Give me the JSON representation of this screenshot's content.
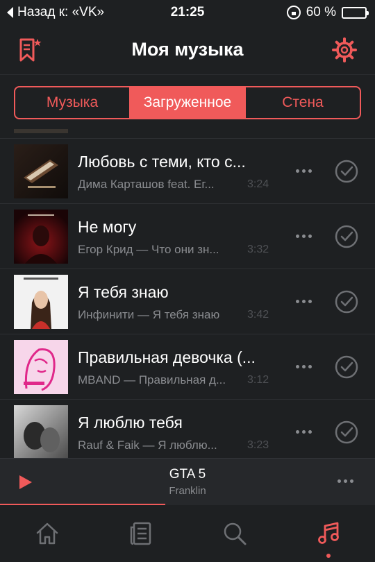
{
  "status_bar": {
    "back_label": "Назад к: «VK»",
    "time": "21:25",
    "battery": "60 %",
    "battery_level": 0.6
  },
  "header": {
    "title": "Моя музыка"
  },
  "segments": [
    {
      "label": "Музыка",
      "active": false
    },
    {
      "label": "Загруженное",
      "active": true
    },
    {
      "label": "Стена",
      "active": false
    }
  ],
  "tracks": [
    {
      "title": "Любовь с теми, кто с...",
      "subtitle": "Дима Карташов feat. Ег...",
      "duration": "3:24",
      "cover_icon": "album-cover-dark-piano"
    },
    {
      "title": "Не могу",
      "subtitle": "Егор Крид — Что они зн...",
      "duration": "3:32",
      "cover_icon": "album-cover-red"
    },
    {
      "title": "Я тебя знаю",
      "subtitle": "Инфинити — Я тебя знаю",
      "duration": "3:42",
      "cover_icon": "album-cover-girl"
    },
    {
      "title": "Правильная девочка (...",
      "subtitle": "MBAND — Правильная д...",
      "duration": "3:12",
      "cover_icon": "album-cover-pink"
    },
    {
      "title": "Я люблю тебя",
      "subtitle": "Rauf & Faik — Я люблю...",
      "duration": "3:23",
      "cover_icon": "album-cover-bw"
    }
  ],
  "player": {
    "title": "GTA 5",
    "artist": "Franklin",
    "progress": 0.44
  },
  "tabbar": [
    {
      "name": "home-icon",
      "active": false
    },
    {
      "name": "news-icon",
      "active": false
    },
    {
      "name": "search-icon",
      "active": false
    },
    {
      "name": "music-icon",
      "active": true
    }
  ],
  "colors": {
    "accent": "#f05a5a",
    "background": "#1e2022",
    "muted": "#8a8c90"
  }
}
